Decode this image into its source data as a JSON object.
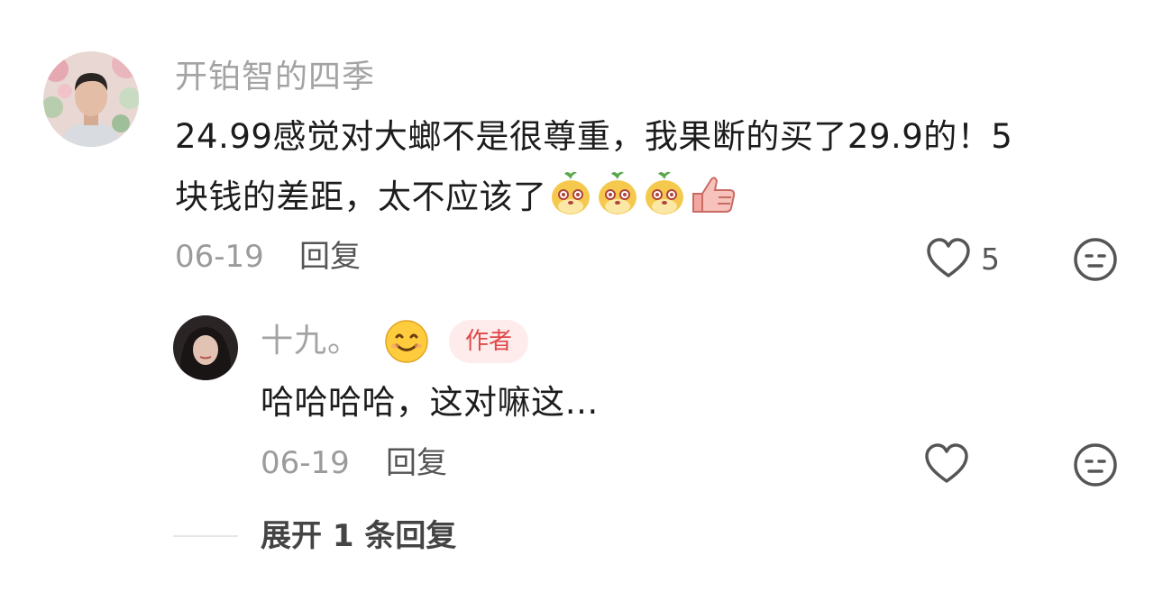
{
  "comment": {
    "username": "开铂智的四季",
    "text_line1": "24.99感觉对大螂不是很尊重，我果断的买了29.9的！5",
    "text_line2": "块钱的差距，太不应该了",
    "date": "06-19",
    "reply_label": "回复",
    "like_count": "5",
    "trailing_emojis": [
      "bean-dog-emoji",
      "bean-dog-emoji",
      "bean-dog-emoji",
      "thumbs-up-emoji"
    ]
  },
  "reply": {
    "username": "十九。",
    "username_emoji": "smile-emoji",
    "author_badge": "作者",
    "text": "哈哈哈哈，这对嘛这…",
    "date": "06-19",
    "reply_label": "回复"
  },
  "expand": {
    "label": "展开 1 条回复"
  },
  "colors": {
    "username": "#a3a3a3",
    "text": "#1c1c1c",
    "badge_bg": "#fdeceb",
    "badge_text": "#e04848"
  }
}
